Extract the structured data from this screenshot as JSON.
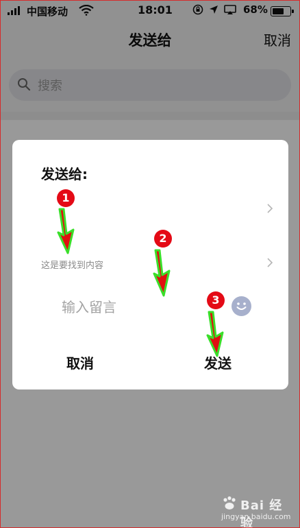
{
  "status_bar": {
    "carrier": "中国移动",
    "time": "18:01",
    "battery": "68%",
    "battery_level": 0.68
  },
  "navbar": {
    "title": "发送给",
    "cancel_label": "取消"
  },
  "search": {
    "placeholder": "搜索"
  },
  "dialog": {
    "title": "发送给:",
    "row2_text": "这是要找到内容",
    "message_placeholder": "输入留言",
    "cancel_label": "取消",
    "send_label": "发送"
  },
  "annotations": [
    {
      "label": "1"
    },
    {
      "label": "2"
    },
    {
      "label": "3"
    }
  ],
  "watermark": {
    "brand": "Bai 经验",
    "domain": "jingyan.baidu.com"
  },
  "colors": {
    "badge": "#e40a16",
    "arrow_fill": "#e01010",
    "arrow_outline": "#3adf2a",
    "overlay": "rgba(0,0,0,0.40)"
  }
}
